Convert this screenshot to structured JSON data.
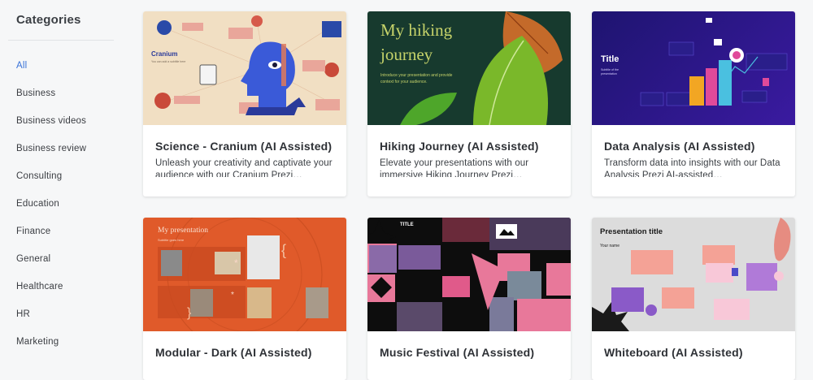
{
  "sidebar": {
    "heading": "Categories",
    "items": [
      {
        "label": "All",
        "active": true
      },
      {
        "label": "Business"
      },
      {
        "label": "Business videos"
      },
      {
        "label": "Business review"
      },
      {
        "label": "Consulting"
      },
      {
        "label": "Education"
      },
      {
        "label": "Finance"
      },
      {
        "label": "General"
      },
      {
        "label": "Healthcare"
      },
      {
        "label": "HR"
      },
      {
        "label": "Marketing"
      }
    ]
  },
  "cards": [
    {
      "title": "Science - Cranium (AI Assisted)",
      "desc": "Unleash your creativity and captivate your audience with our Cranium Prezi…",
      "thumb_title": "Cranium",
      "thumb_sub": "You can add a subtitle here"
    },
    {
      "title": "Hiking Journey (AI Assisted)",
      "desc": "Elevate your presentations with our immersive Hiking Journey Prezi…",
      "thumb_title_1": "My hiking",
      "thumb_title_2": "journey",
      "thumb_sub_1": "Introduce your presentation and provide",
      "thumb_sub_2": "context for your audience."
    },
    {
      "title": "Data Analysis (AI Assisted)",
      "desc": "Transform data into insights with our Data Analysis Prezi AI-assisted…",
      "thumb_title": "Title",
      "thumb_sub_1": "Subtitle of the",
      "thumb_sub_2": "presentation"
    },
    {
      "title": "Modular - Dark (AI Assisted)",
      "thumb_title": "My presentation",
      "thumb_sub": "Subtitle goes here"
    },
    {
      "title": "Music Festival (AI Assisted)",
      "thumb_title": "TITLE"
    },
    {
      "title": "Whiteboard (AI Assisted)",
      "thumb_title": "Presentation title",
      "thumb_sub": "Your name"
    }
  ],
  "colors": {
    "accent": "#3a73d8",
    "cranium_bg": "#f1dfc3",
    "hiking_bg": "#173a2e",
    "data_bg": "#2a1a78",
    "modular_bg": "#e05a2a",
    "music_bg": "#0d0d0d",
    "whiteboard_bg": "#dcdcdc"
  }
}
